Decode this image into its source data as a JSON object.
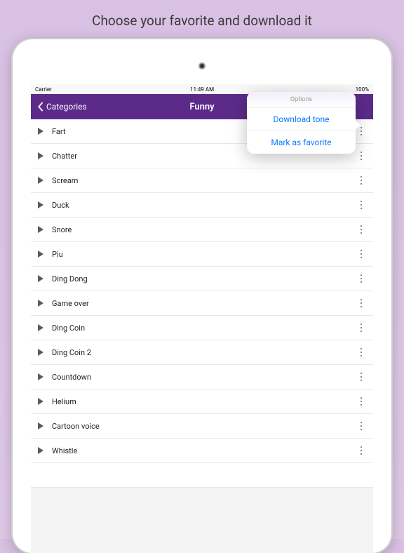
{
  "promo": "Choose your favorite and download it",
  "status": {
    "carrier": "Carrier",
    "time": "11:49 AM",
    "battery": "100%"
  },
  "nav": {
    "back": "Categories",
    "title": "Funny"
  },
  "popover": {
    "header": "Options",
    "download": "Download tone",
    "favorite": "Mark as favorite"
  },
  "tones": [
    {
      "label": "Fart"
    },
    {
      "label": "Chatter"
    },
    {
      "label": "Scream"
    },
    {
      "label": "Duck"
    },
    {
      "label": "Snore"
    },
    {
      "label": "Piu"
    },
    {
      "label": "Ding Dong"
    },
    {
      "label": "Game over"
    },
    {
      "label": "Ding Coin"
    },
    {
      "label": "Ding Coin 2"
    },
    {
      "label": "Countdown"
    },
    {
      "label": "Helium"
    },
    {
      "label": "Cartoon voice"
    },
    {
      "label": "Whistle"
    }
  ]
}
